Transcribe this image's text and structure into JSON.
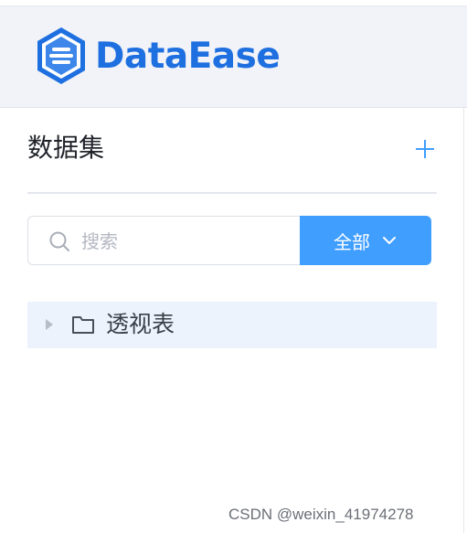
{
  "header": {
    "brand": "DataEase",
    "logo_icon": "dataease-logo-icon",
    "brand_color": "#1e6fe0",
    "background": "#f1f3f8"
  },
  "panel": {
    "title": "数据集",
    "add_icon": "plus-icon"
  },
  "search": {
    "placeholder": "搜索",
    "value": "",
    "icon": "search-icon"
  },
  "filter": {
    "label": "全部",
    "icon": "chevron-down-icon",
    "accent": "#409eff"
  },
  "tree": {
    "items": [
      {
        "label": "透视表",
        "icon": "folder-icon",
        "expanded": false
      }
    ],
    "highlight": "#ecf3fd"
  },
  "watermark": "CSDN @weixin_41974278"
}
